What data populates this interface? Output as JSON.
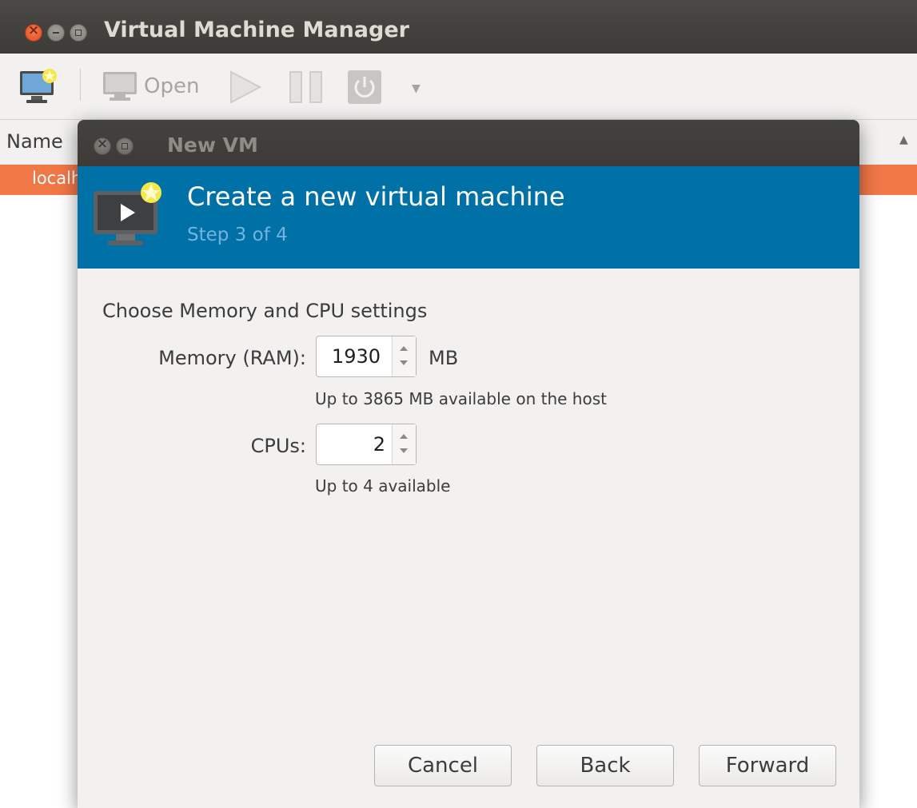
{
  "main_window": {
    "title": "Virtual Machine Manager",
    "toolbar": {
      "open_label": "Open"
    },
    "list": {
      "column_name": "Name",
      "row_text": "localhost"
    }
  },
  "dialog": {
    "title": "New VM",
    "heading": "Create a new virtual machine",
    "step": "Step 3 of 4",
    "section_title": "Choose Memory and CPU settings",
    "memory": {
      "label": "Memory (RAM):",
      "value": "1930",
      "unit": "MB",
      "hint": "Up to 3865 MB available on the host"
    },
    "cpus": {
      "label": "CPUs:",
      "value": "2",
      "hint": "Up to 4 available"
    },
    "buttons": {
      "cancel": "Cancel",
      "back": "Back",
      "forward": "Forward"
    }
  },
  "colors": {
    "header_blue": "#0071a6",
    "selection_orange": "#f07746",
    "titlebar_dark": "#3c3b37"
  }
}
